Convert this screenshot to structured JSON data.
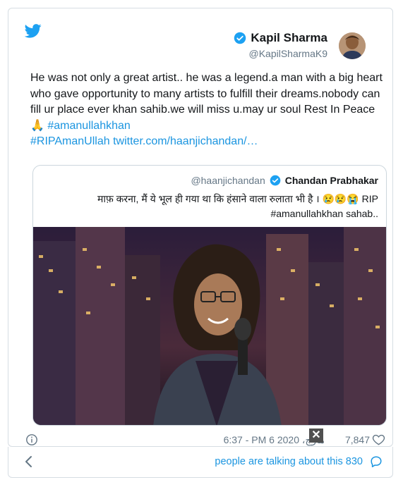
{
  "tweet": {
    "author_name": "Kapil Sharma",
    "author_handle": "@KapilSharmaK9",
    "text_plain": "He was not only a great artist.. he was a legend.a man with a big heart who gave opportunity to many artists to fulfill their dreams.nobody can fill ur place ever khan sahib.we will miss u.may ur soul Rest In Peace 🙏 ",
    "hashtag1": "#amanullahkhan",
    "hashtag2": "#RIPAmanUllah",
    "link": "twitter.com/haanjichandan/…",
    "timestamp": "6:37 - PM 6 مارچ، 2020",
    "likes": "7,847"
  },
  "quote": {
    "handle": "@haanjichandan",
    "name": "Chandan Prabhakar",
    "text": "माफ़ करना, मैं ये भूल ही गया था कि हंसाने वाला रुलाता भी है । 😢😢😭 RIP #amanullahkhan sahab.."
  },
  "footer": {
    "people_text": "people are talking about this 830"
  },
  "colors": {
    "link": "#1b95e0",
    "verified": "#1da1f2",
    "muted": "#657786"
  },
  "icons": [
    "twitter-bird-icon",
    "verified-badge-icon",
    "info-icon",
    "heart-icon",
    "chevron-left-icon",
    "comment-bubble-icon",
    "close-icon"
  ]
}
